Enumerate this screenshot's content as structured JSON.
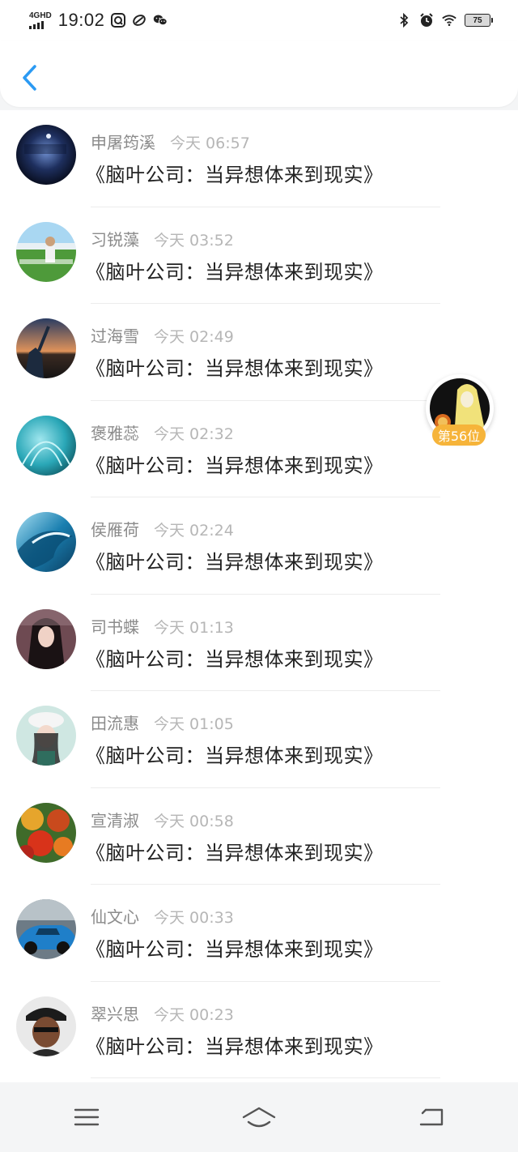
{
  "status_bar": {
    "network": "4GHD",
    "time": "19:02",
    "battery": "75"
  },
  "header": {
    "back_icon": "chevron-left-icon"
  },
  "floating_rank": {
    "label": "第56位"
  },
  "items": [
    {
      "name": "申屠筠溪",
      "time": "今天 06:57",
      "content": "《脑叶公司：当异想体来到现实》"
    },
    {
      "name": "习锐藻",
      "time": "今天 03:52",
      "content": "《脑叶公司：当异想体来到现实》"
    },
    {
      "name": "过海雪",
      "time": "今天 02:49",
      "content": "《脑叶公司：当异想体来到现实》"
    },
    {
      "name": "褒雅蕊",
      "time": "今天 02:32",
      "content": "《脑叶公司：当异想体来到现实》"
    },
    {
      "name": "侯雁荷",
      "time": "今天 02:24",
      "content": "《脑叶公司：当异想体来到现实》"
    },
    {
      "name": "司书蝶",
      "time": "今天 01:13",
      "content": "《脑叶公司：当异想体来到现实》"
    },
    {
      "name": "田流惠",
      "time": "今天 01:05",
      "content": "《脑叶公司：当异想体来到现实》"
    },
    {
      "name": "宣清淑",
      "time": "今天 00:58",
      "content": "《脑叶公司：当异想体来到现实》"
    },
    {
      "name": "仙文心",
      "time": "今天 00:33",
      "content": "《脑叶公司：当异想体来到现实》"
    },
    {
      "name": "翠兴思",
      "time": "今天 00:23",
      "content": "《脑叶公司：当异想体来到现实》"
    }
  ],
  "nav_bar": {
    "menu_icon": "menu-icon",
    "home_icon": "home-icon",
    "back_icon": "back-icon"
  },
  "colors": {
    "accent": "#2b9af3",
    "badge": "#f6b43a",
    "name_text": "#8b8b8b",
    "time_text": "#b6b6b6",
    "content_text": "#222222"
  }
}
